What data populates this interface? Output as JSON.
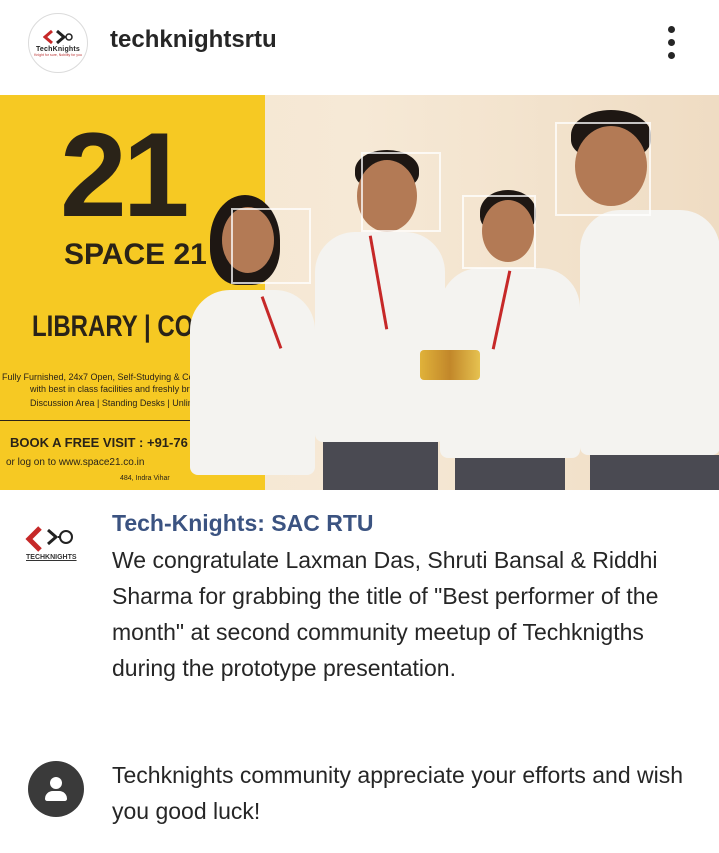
{
  "header": {
    "username": "techknightsrtu",
    "avatar_brand": "TechKnights",
    "avatar_tagline": "Knight for sure, Nobility for you",
    "more_icon": "more-vertical-icon"
  },
  "photo": {
    "poster": {
      "number": "21",
      "name": "SPACE 21",
      "library_line": "LIBRARY | CO-W",
      "info_line_1": "Fully Furnished, 24x7 Open, Self-Studying & Co-w",
      "info_line_1b": "with best in class facilities and freshly brewe",
      "info_line_2": "Discussion Area | Standing Desks | Unlimite",
      "book": "BOOK A FREE VISIT : +91-76",
      "log": "or log on to www.space21.co.in",
      "address": "484, Indra Vihar"
    },
    "colors": {
      "poster": "#f6c923",
      "wall": "#f3e5cf",
      "shirt": "#f4f3f0",
      "lanyard": "#c62828"
    }
  },
  "post": {
    "author": "Tech-Knights: SAC RTU",
    "caption": "We congratulate Laxman Das, Shruti Bansal & Riddhi Sharma for grabbing the title of \"Best performer of the month\" at second community meetup of Techknigths during the prototype presentation.",
    "logo_brand": "TECHKNIGHTS"
  },
  "comment": {
    "avatar_icon": "default-user-icon",
    "text": "Techknights community appreciate your efforts and wish you good luck!"
  }
}
